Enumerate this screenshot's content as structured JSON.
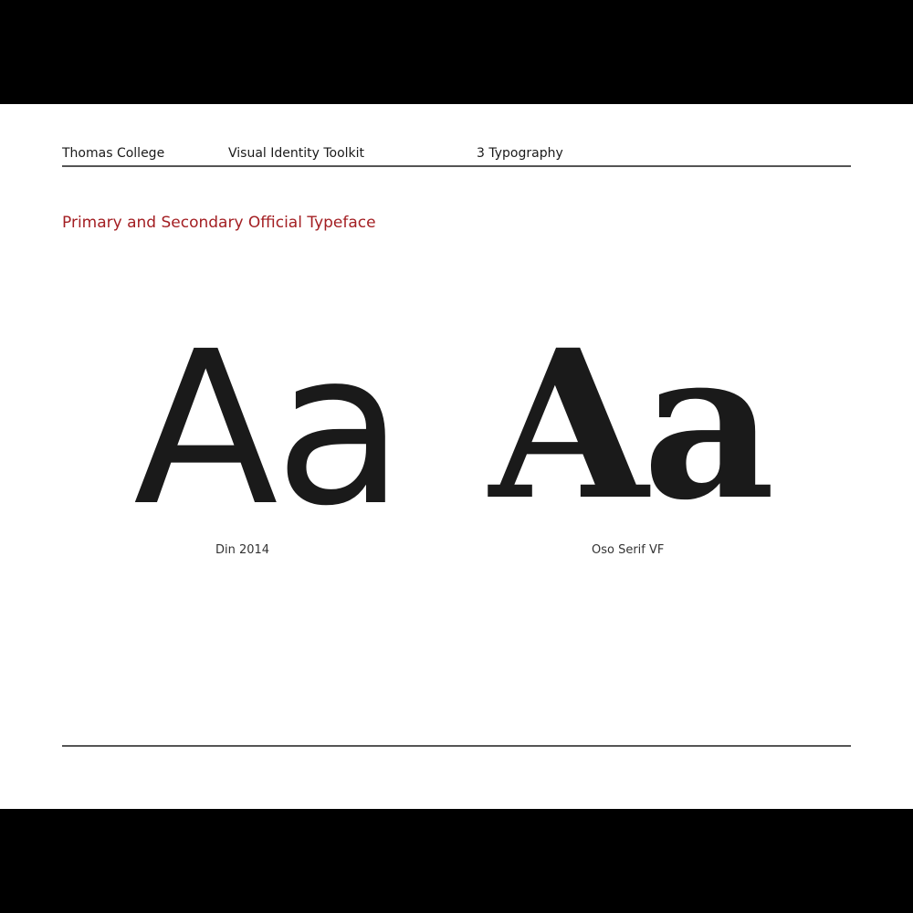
{
  "header": {
    "organization": "Thomas College",
    "document": "Visual Identity Toolkit",
    "section": "3 Typography"
  },
  "title": "Primary and Secondary Official Typeface",
  "typefaces": [
    {
      "specimen": "Aa",
      "name": "Din 2014"
    },
    {
      "specimen": "Aa",
      "name": "Oso Serif VF"
    }
  ],
  "colors": {
    "accent": "#a31e22",
    "text": "#1a1a1a",
    "rule": "#555555",
    "background": "#ffffff",
    "letterbox": "#000000"
  }
}
